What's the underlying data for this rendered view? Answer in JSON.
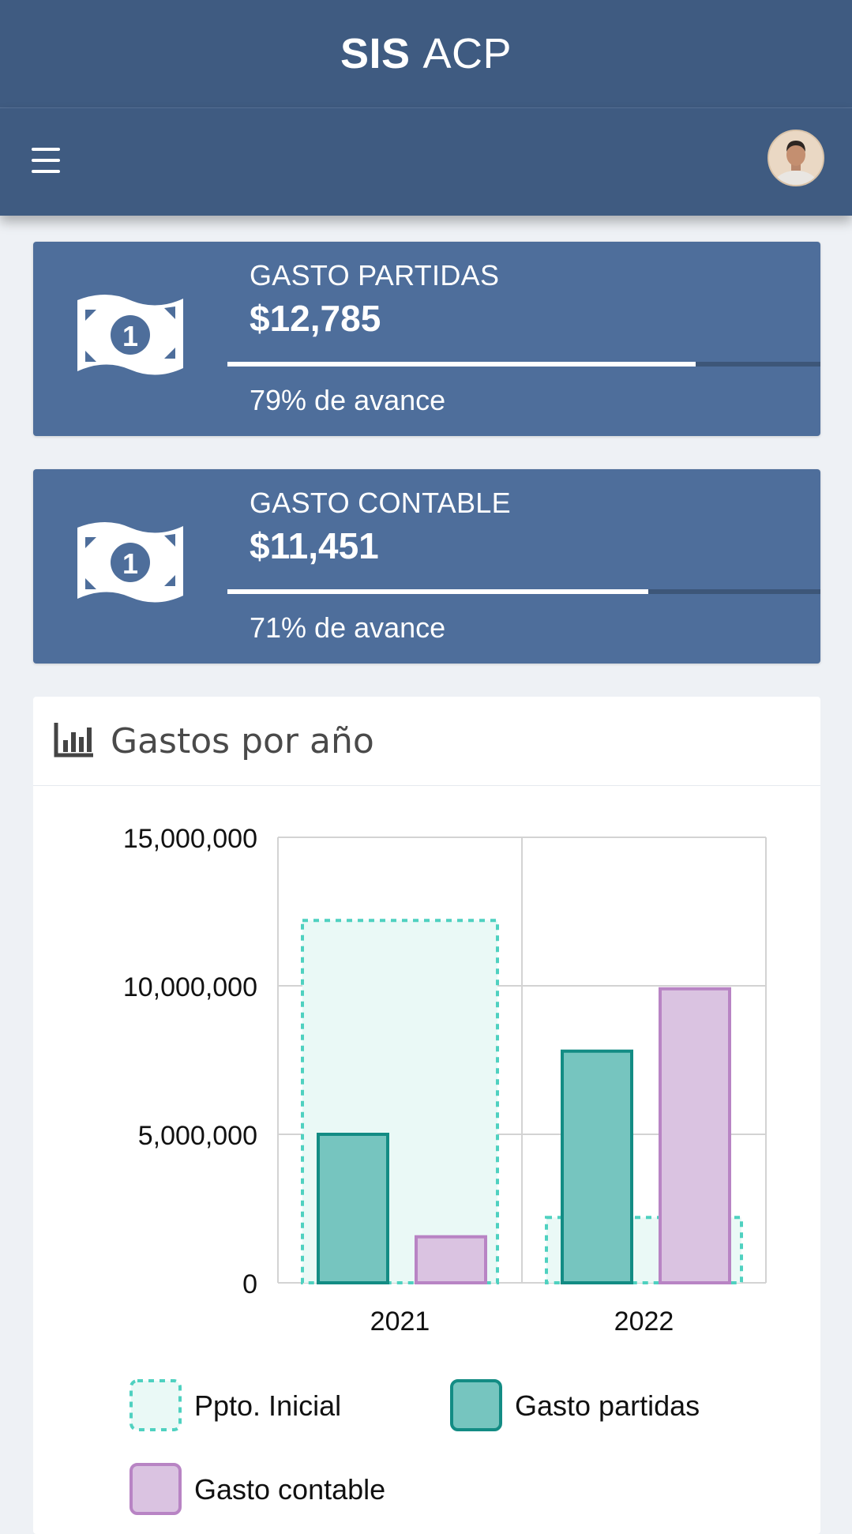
{
  "app": {
    "title_bold": "SIS",
    "title_rest": "ACP"
  },
  "nav": {
    "menu_icon": "hamburger-icon",
    "avatar_icon": "user-avatar"
  },
  "cards": [
    {
      "title": "GASTO PARTIDAS",
      "value": "$12,785",
      "progress": 0.79,
      "note": "79% de avance",
      "icon": "money-bill-icon"
    },
    {
      "title": "GASTO CONTABLE",
      "value": "$11,451",
      "progress": 0.71,
      "note": "71% de avance",
      "icon": "money-bill-icon"
    }
  ],
  "chart_panel": {
    "title": "Gastos por año",
    "icon": "chart-bar-icon"
  },
  "colors": {
    "header": "#3f5b81",
    "card": "#4e6e9b",
    "ppto_border": "#4fd1c0",
    "ppto_fill": "#eaf9f6",
    "partidas_border": "#138c84",
    "partidas_fill": "#76c5bf",
    "contable_border": "#b884c4",
    "contable_fill": "#dac3e1"
  },
  "chart_data": {
    "type": "bar",
    "categories": [
      "2021",
      "2022"
    ],
    "series": [
      {
        "name": "Ppto. Inicial",
        "values": [
          12200000,
          2200000
        ]
      },
      {
        "name": "Gasto partidas",
        "values": [
          5000000,
          7800000
        ]
      },
      {
        "name": "Gasto contable",
        "values": [
          1550000,
          9900000
        ]
      }
    ],
    "yticks": [
      "0",
      "5,000,000",
      "10,000,000",
      "15,000,000"
    ],
    "ylim": [
      0,
      15000000
    ],
    "grid": true,
    "legend": "bottom"
  }
}
